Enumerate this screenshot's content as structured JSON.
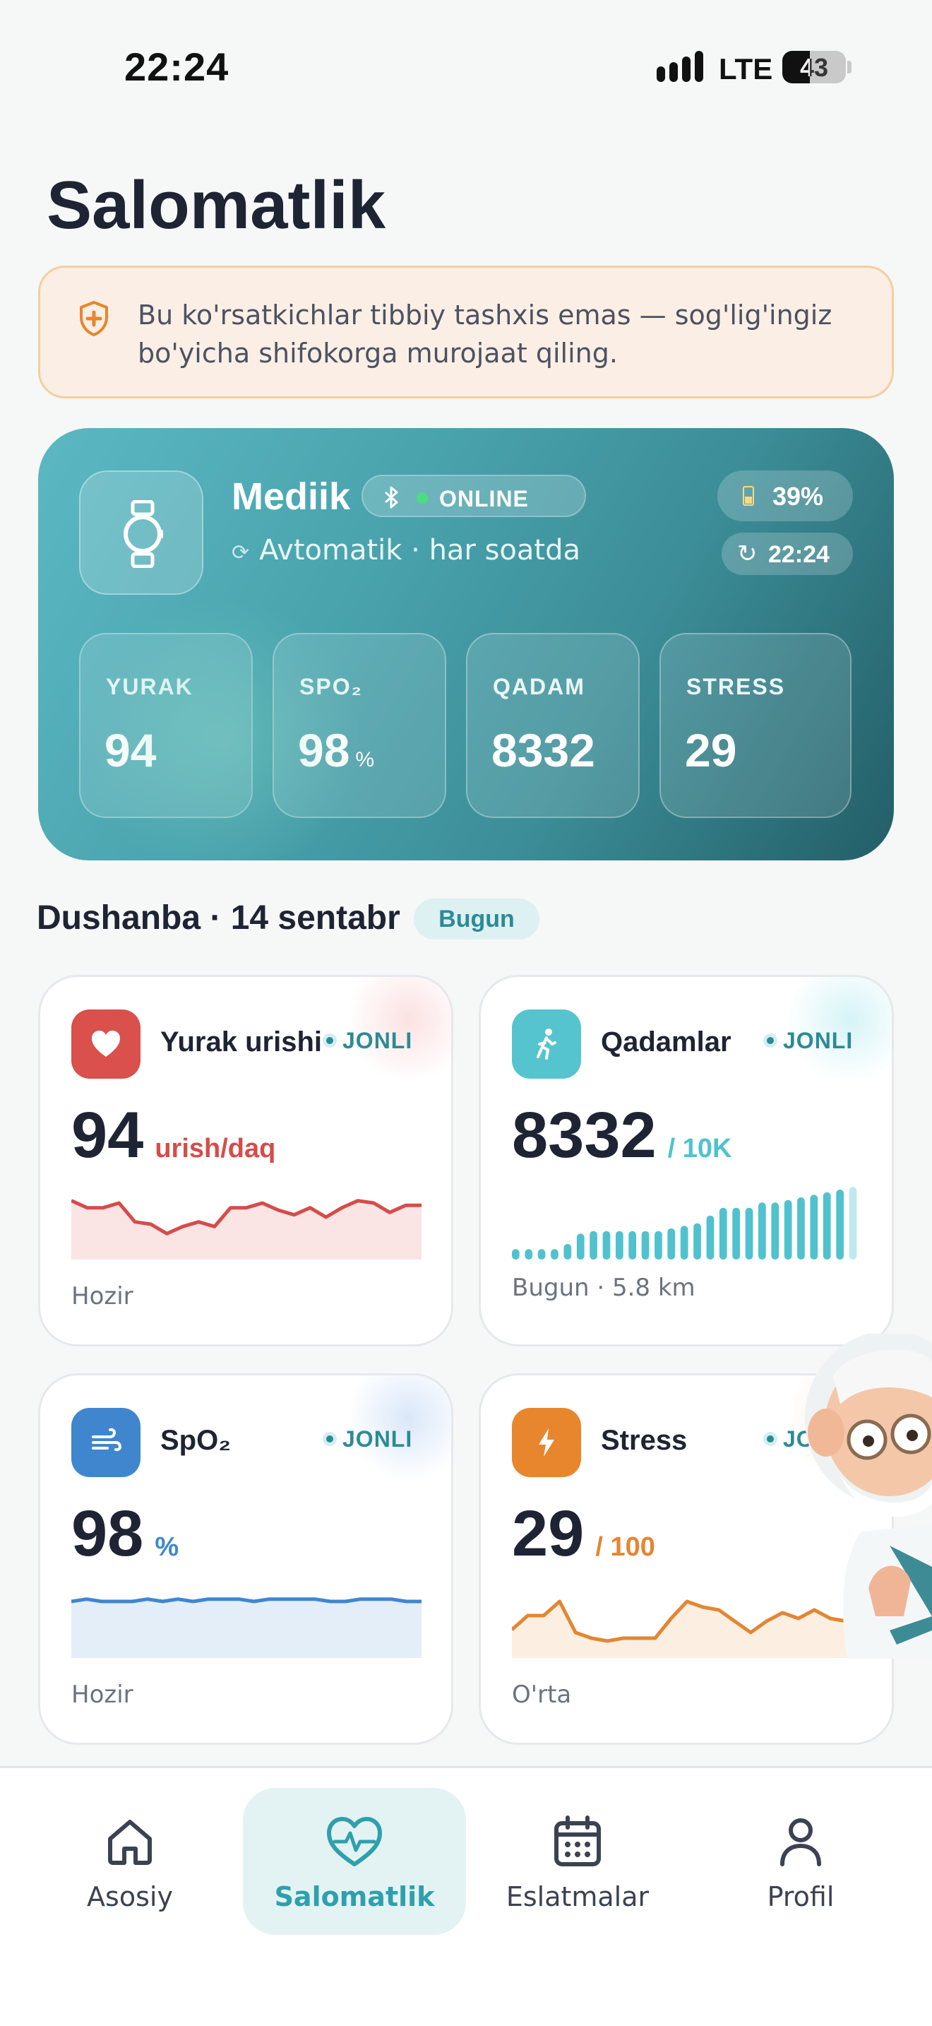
{
  "status_bar": {
    "time": "22:24",
    "network": "LTE",
    "battery": "43",
    "battery_level": 0.43
  },
  "page": {
    "title": "Salomatlik"
  },
  "disclaimer": {
    "text": "Bu ko'rsatkichlar tibbiy tashxis emas — sog'lig'ingiz bo'yicha shifokorga murojaat qiling."
  },
  "device": {
    "name": "Mediik",
    "status": "ONLINE",
    "sync": "Avtomatik · har soatda",
    "battery": "39%",
    "last_sync": "22:24",
    "metrics": [
      {
        "label": "YURAK",
        "value": "94",
        "unit": ""
      },
      {
        "label": "SPO₂",
        "value": "98",
        "unit": "%"
      },
      {
        "label": "QADAM",
        "value": "8332",
        "unit": ""
      },
      {
        "label": "STRESS",
        "value": "29",
        "unit": ""
      }
    ]
  },
  "date_row": {
    "date": "Dushanba · 14 sentabr",
    "badge": "Bugun"
  },
  "cards": {
    "heart": {
      "title": "Yurak urishi",
      "live": "JONLI",
      "value": "94",
      "unit": "urish/daq",
      "footer": "Hozir",
      "color": "#d44d4a"
    },
    "steps": {
      "title": "Qadamlar",
      "live": "JONLI",
      "value": "8332",
      "unit": "/ 10K",
      "footer": "Bugun · 5.8 km",
      "color": "#4fc2ce"
    },
    "spo2": {
      "title": "SpO₂",
      "live": "JONLI",
      "value": "98",
      "unit": "%",
      "footer": "Hozir",
      "color": "#3f86cf"
    },
    "stress": {
      "title": "Stress",
      "live": "JONLI",
      "value": "29",
      "unit": "/ 100",
      "footer": "O'rta",
      "color": "#e38632"
    }
  },
  "chart_data": [
    {
      "type": "area",
      "name": "heart",
      "values": [
        50,
        44,
        44,
        48,
        32,
        30,
        22,
        28,
        32,
        28,
        44,
        44,
        48,
        42,
        38,
        44,
        36,
        44,
        50,
        48,
        40,
        46,
        46
      ],
      "ylim": [
        0,
        60
      ]
    },
    {
      "type": "bar",
      "name": "steps",
      "values": [
        4,
        4,
        4,
        4,
        6,
        10,
        11,
        11,
        11,
        11,
        11,
        11,
        12,
        13,
        14,
        17,
        20,
        20,
        20,
        22,
        22,
        23,
        24,
        25,
        26,
        27,
        28
      ],
      "ylim": [
        0,
        30
      ]
    },
    {
      "type": "area",
      "name": "spo2",
      "values": [
        48,
        50,
        48,
        48,
        48,
        50,
        48,
        50,
        48,
        50,
        50,
        50,
        48,
        50,
        50,
        50,
        50,
        48,
        48,
        50,
        50,
        50,
        48,
        48
      ],
      "ylim": [
        0,
        60
      ]
    },
    {
      "type": "area",
      "name": "stress",
      "values": [
        20,
        30,
        30,
        40,
        18,
        14,
        12,
        14,
        14,
        14,
        28,
        40,
        36,
        34,
        26,
        18,
        26,
        32,
        28,
        34,
        28,
        26,
        26
      ],
      "ylim": [
        0,
        50
      ]
    }
  ],
  "tabs": [
    {
      "label": "Asosiy",
      "icon": "home-icon",
      "active": false
    },
    {
      "label": "Salomatlik",
      "icon": "heart-pulse-icon",
      "active": true
    },
    {
      "label": "Eslatmalar",
      "icon": "calendar-icon",
      "active": false
    },
    {
      "label": "Profil",
      "icon": "user-icon",
      "active": false
    }
  ]
}
